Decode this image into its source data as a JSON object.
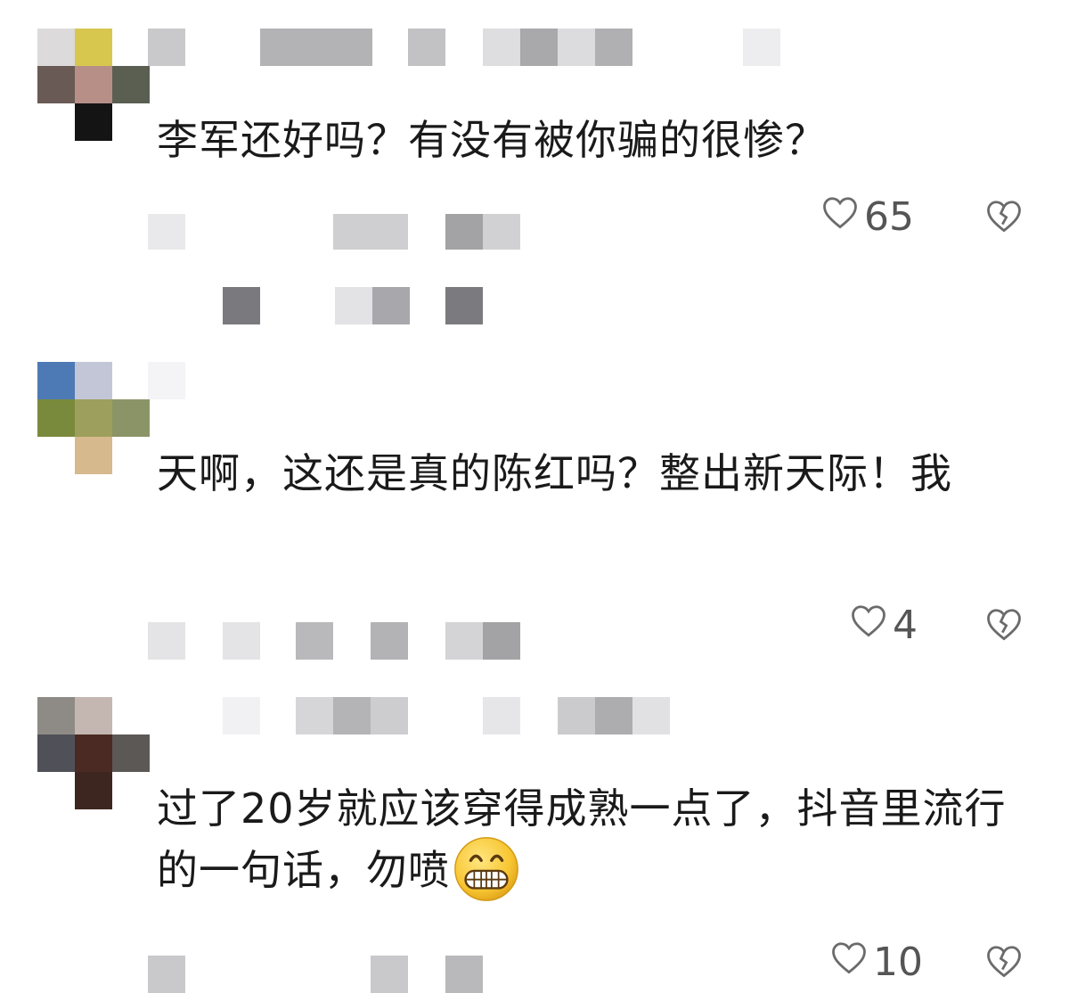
{
  "comments": [
    {
      "text": "李军还好吗？有没有被你骗的很惨？",
      "likes": "65"
    },
    {
      "text": "天啊，这还是真的陈红吗？整出新天际！我",
      "likes": "4"
    },
    {
      "text": "过了20岁就应该穿得成熟一点了，抖音里流行的一句话，勿喷",
      "likes": "10"
    }
  ],
  "icons": {
    "like": "heart-outline-icon",
    "dislike": "broken-heart-icon",
    "emoji": "grinning-face-emoji"
  },
  "colors": {
    "text": "#1a1a1a",
    "meta": "#555555",
    "mosaic_light": "#e3e3e6",
    "mosaic_mid": "#b3b3b7",
    "mosaic_dark": "#7a7a7e"
  }
}
